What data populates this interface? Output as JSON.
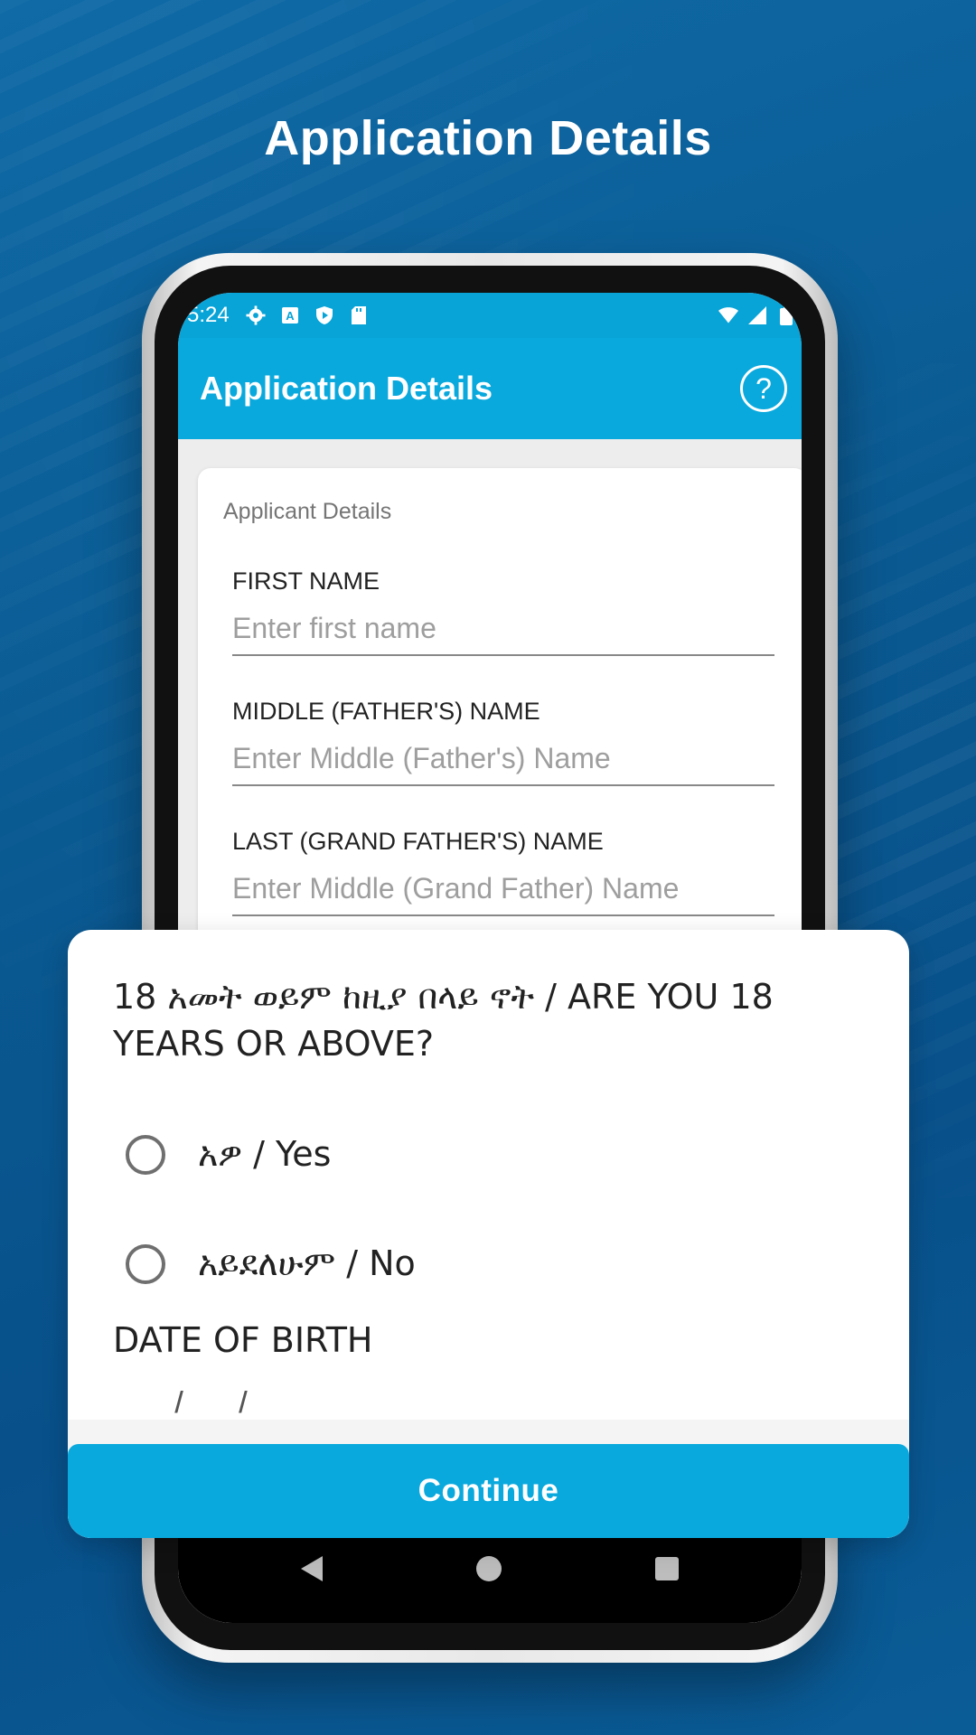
{
  "headline": "Application Details",
  "statusbar": {
    "time": "5:24",
    "left_icons": [
      "gear-icon",
      "font-a-icon",
      "shield-icon",
      "sd-card-icon"
    ],
    "right_icons": [
      "wifi-icon",
      "signal-icon",
      "battery-icon"
    ]
  },
  "appbar": {
    "title": "Application Details",
    "help_label": "?"
  },
  "card": {
    "title": "Applicant Details",
    "fields": [
      {
        "label": "FIRST NAME",
        "placeholder": "Enter first name",
        "value": ""
      },
      {
        "label": "MIDDLE (FATHER'S) NAME",
        "placeholder": "Enter Middle (Father's) Name",
        "value": ""
      },
      {
        "label": "LAST (GRAND FATHER'S) NAME",
        "placeholder": "Enter Middle (Grand Father) Name",
        "value": ""
      }
    ]
  },
  "sheet": {
    "question": "18 አመት ወይም ከዚያ በላይ ኖት / ARE YOU 18 YEARS OR ABOVE?",
    "options": [
      {
        "label": "አዎ / Yes",
        "selected": false
      },
      {
        "label": "አይደለሁም / No",
        "selected": false
      }
    ],
    "dob_label": "DATE OF BIRTH",
    "dob_value": "__/__/____",
    "continue_label": "Continue"
  },
  "colors": {
    "background": "#0a5a92",
    "accent": "#09a9dd",
    "white": "#ffffff"
  }
}
